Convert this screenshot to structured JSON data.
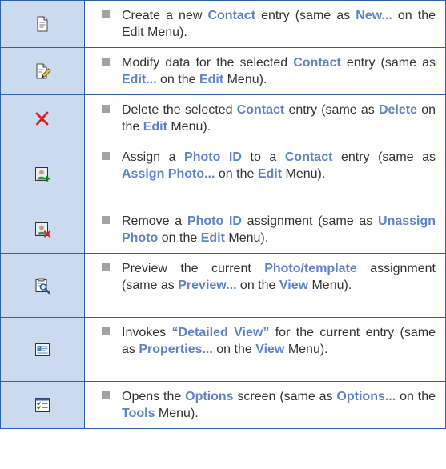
{
  "rows": [
    {
      "icon": "new-document-icon",
      "description": [
        {
          "text": "Create a new "
        },
        {
          "text": "Contact",
          "kw": true
        },
        {
          "text": " entry (same as "
        },
        {
          "text": "New...",
          "kw": true
        },
        {
          "text": " on the Edit Menu)."
        }
      ]
    },
    {
      "icon": "edit-document-icon",
      "description": [
        {
          "text": "Modify data for the selected "
        },
        {
          "text": "Contact",
          "kw": true
        },
        {
          "text": " entry (same as "
        },
        {
          "text": "Edit...",
          "kw": true
        },
        {
          "text": " on the "
        },
        {
          "text": "Edit",
          "kw": true
        },
        {
          "text": " Menu)."
        }
      ]
    },
    {
      "icon": "delete-x-icon",
      "description": [
        {
          "text": "Delete the selected  "
        },
        {
          "text": "Contact",
          "kw": true
        },
        {
          "text": " entry (same as "
        },
        {
          "text": "Delete",
          "kw": true
        },
        {
          "text": " on the "
        },
        {
          "text": "Edit",
          "kw": true
        },
        {
          "text": " Menu)."
        }
      ]
    },
    {
      "icon": "assign-photo-icon",
      "description": [
        {
          "text": "Assign a "
        },
        {
          "text": "Photo ID",
          "kw": true
        },
        {
          "text": " to a  "
        },
        {
          "text": "Contact",
          "kw": true
        },
        {
          "text": "  entry (same as "
        },
        {
          "text": "Assign Photo...",
          "kw": true
        },
        {
          "text": " on the "
        },
        {
          "text": "Edit",
          "kw": true
        },
        {
          "text": " Menu)."
        }
      ]
    },
    {
      "icon": "unassign-photo-icon",
      "description": [
        {
          "text": "Remove a "
        },
        {
          "text": "Photo ID",
          "kw": true
        },
        {
          "text": " assignment (same as "
        },
        {
          "text": "Unassign Photo",
          "kw": true
        },
        {
          "text": " on the "
        },
        {
          "text": "Edit",
          "kw": true
        },
        {
          "text": " Menu)."
        }
      ]
    },
    {
      "icon": "preview-magnifier-icon",
      "description": [
        {
          "text": "Preview the current "
        },
        {
          "text": "Photo/template",
          "kw": true
        },
        {
          "text": " as­signment (same as "
        },
        {
          "text": "Preview...",
          "kw": true
        },
        {
          "text": " on the "
        },
        {
          "text": "View",
          "kw": true
        },
        {
          "text": " Menu)."
        }
      ]
    },
    {
      "icon": "detailed-view-icon",
      "description": [
        {
          "text": "Invokes "
        },
        {
          "text": "“Detailed View”",
          "kw": true
        },
        {
          "text": " for the current entry (same as "
        },
        {
          "text": "Properties...",
          "kw": true
        },
        {
          "text": " on the  "
        },
        {
          "text": "View",
          "kw": true
        },
        {
          "text": " Menu)."
        }
      ]
    },
    {
      "icon": "options-checklist-icon",
      "description": [
        {
          "text": "Opens the "
        },
        {
          "text": "Options",
          "kw": true
        },
        {
          "text": " screen (same as "
        },
        {
          "text": "Op­tions...",
          "kw": true
        },
        {
          "text": " on the "
        },
        {
          "text": "Tools",
          "kw": true
        },
        {
          "text": " Menu)."
        }
      ]
    }
  ],
  "colors": {
    "border": "#2a61a8",
    "icon_cell_background": "#ccdaf0",
    "keyword": "#5f83c8",
    "body_text": "#333333",
    "bullet": "#a3a3a3"
  }
}
